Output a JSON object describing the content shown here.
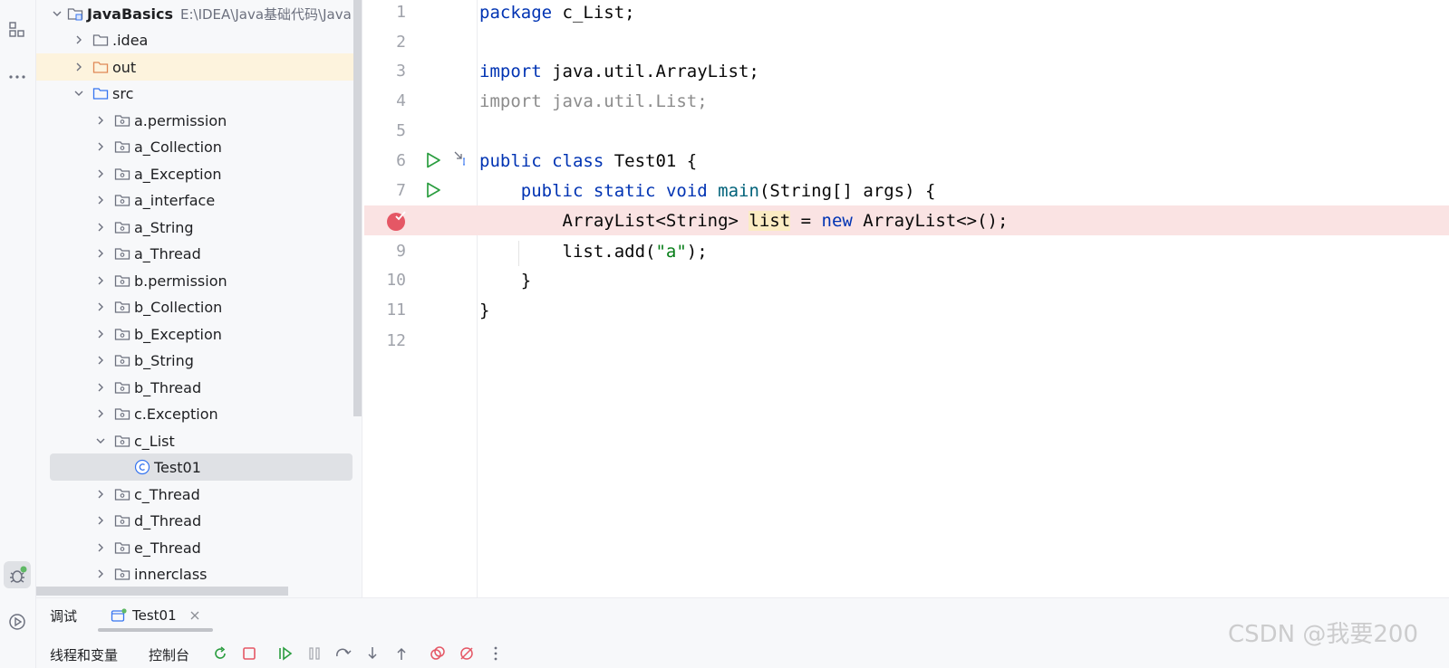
{
  "project": {
    "name": "JavaBasics",
    "path": "E:\\IDEA\\Java基础代码\\Java",
    "items": [
      {
        "label": ".idea",
        "kind": "folder"
      },
      {
        "label": "out",
        "kind": "folder-orange"
      },
      {
        "label": "src",
        "kind": "folder-blue"
      },
      {
        "label": "a.permission",
        "kind": "package"
      },
      {
        "label": "a_Collection",
        "kind": "package"
      },
      {
        "label": "a_Exception",
        "kind": "package"
      },
      {
        "label": "a_interface",
        "kind": "package"
      },
      {
        "label": "a_String",
        "kind": "package"
      },
      {
        "label": "a_Thread",
        "kind": "package"
      },
      {
        "label": "b.permission",
        "kind": "package"
      },
      {
        "label": "b_Collection",
        "kind": "package"
      },
      {
        "label": "b_Exception",
        "kind": "package"
      },
      {
        "label": "b_String",
        "kind": "package"
      },
      {
        "label": "b_Thread",
        "kind": "package"
      },
      {
        "label": "c.Exception",
        "kind": "package"
      },
      {
        "label": "c_List",
        "kind": "package"
      },
      {
        "label": "Test01",
        "kind": "class"
      },
      {
        "label": "c_Thread",
        "kind": "package"
      },
      {
        "label": "d_Thread",
        "kind": "package"
      },
      {
        "label": "e_Thread",
        "kind": "package"
      },
      {
        "label": "innerclass",
        "kind": "package"
      }
    ]
  },
  "editor": {
    "line_numbers": [
      "1",
      "2",
      "3",
      "4",
      "5",
      "6",
      "7",
      "8",
      "9",
      "10",
      "11",
      "12"
    ],
    "lines": {
      "l1": {
        "kw": "package",
        "rest": " c_List;"
      },
      "l3": {
        "kw": "import",
        "rest": " java.util.ArrayList;"
      },
      "l4": {
        "text": "import java.util.List;"
      },
      "l6": {
        "kw1": "public",
        "kw2": "class",
        "rest": " Test01 {"
      },
      "l7": {
        "indent": "    ",
        "kw1": "public",
        "kw2": "static",
        "kw3": "void",
        "fn": "main",
        "rest": "(String[] args) {"
      },
      "l8": {
        "indent": "        ",
        "pre": "ArrayList<String> ",
        "var": "list",
        "mid": " = ",
        "kw": "new",
        "rest": " ArrayList<>();"
      },
      "l9": {
        "indent": "        ",
        "pre": "list.add(",
        "str": "\"a\"",
        "rest": ");"
      },
      "l10": {
        "text": "    }"
      },
      "l11": {
        "text": "}"
      }
    }
  },
  "bottom_panel": {
    "tab_debug": "调试",
    "tab_session": "Test01",
    "sub_threads": "线程和变量",
    "sub_console": "控制台"
  },
  "watermark": "CSDN @我要200",
  "colors": {
    "keyword": "#0033b3",
    "string": "#067d17",
    "function": "#00627a",
    "breakpoint_line": "#fae3e3",
    "breakpoint": "#e55765",
    "run_icon": "#2a9d3f"
  }
}
